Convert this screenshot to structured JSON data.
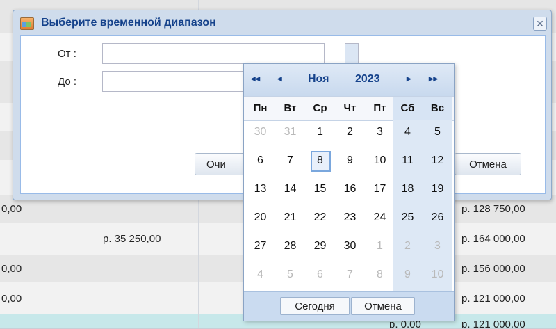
{
  "background_table": {
    "rows": [
      {
        "c0": "0,00",
        "c1": "",
        "c2": "р. 128 750,00"
      },
      {
        "c0": "",
        "c1": "р. 35 250,00",
        "c2": "р. 164 000,00"
      },
      {
        "c0": "0,00",
        "c1": "",
        "c2": "р. 156 000,00"
      },
      {
        "c0": "0,00",
        "c1": "",
        "c2": "р. 121 000,00"
      },
      {
        "c0": "",
        "c1": "р. 0,00",
        "c2": "р. 121 000,00"
      }
    ]
  },
  "dialog": {
    "title": "Выберите временной диапазон",
    "from_label": "От :",
    "to_label": "До :",
    "from_value": "",
    "to_value": "",
    "clear_label": "Очи",
    "cancel_label": "Отмена"
  },
  "datepicker": {
    "nav": {
      "prev_year": "◂◂",
      "prev_month": "◂",
      "next_month": "▸",
      "next_year": "▸▸"
    },
    "month": "Ноя",
    "year": "2023",
    "weekdays": [
      "Пн",
      "Вт",
      "Ср",
      "Чт",
      "Пт",
      "Сб",
      "Вс"
    ],
    "weeks": [
      [
        "30",
        "31",
        "1",
        "2",
        "3",
        "4",
        "5"
      ],
      [
        "6",
        "7",
        "8",
        "9",
        "10",
        "11",
        "12"
      ],
      [
        "13",
        "14",
        "15",
        "16",
        "17",
        "18",
        "19"
      ],
      [
        "20",
        "21",
        "22",
        "23",
        "24",
        "25",
        "26"
      ],
      [
        "27",
        "28",
        "29",
        "30",
        "1",
        "2",
        "3"
      ],
      [
        "4",
        "5",
        "6",
        "7",
        "8",
        "9",
        "10"
      ]
    ],
    "today": "Сегодня",
    "cancel": "Отмена"
  },
  "colors": {
    "accent": "#15428b",
    "selected_border": "#7aa7dd",
    "weekend_bg": "#dde8f5"
  }
}
